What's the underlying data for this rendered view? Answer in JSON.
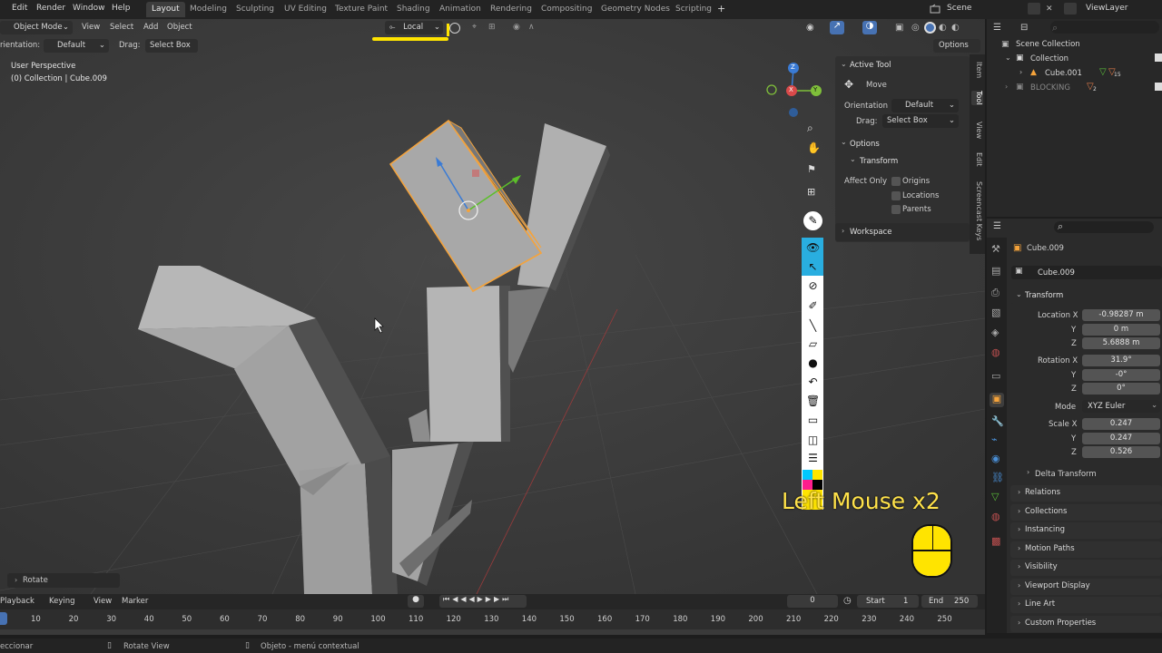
{
  "topbar": {
    "menus": [
      "Edit",
      "Render",
      "Window",
      "Help"
    ],
    "workspaces": [
      "Layout",
      "Modeling",
      "Sculpting",
      "UV Editing",
      "Texture Paint",
      "Shading",
      "Animation",
      "Rendering",
      "Compositing",
      "Geometry Nodes",
      "Scripting"
    ],
    "active_workspace": "Layout",
    "add_tab": "+",
    "scene": "Scene",
    "view_layer": "ViewLayer"
  },
  "viewport_header": {
    "mode": "Object Mode",
    "menus": [
      "View",
      "Select",
      "Add",
      "Object"
    ],
    "transform_orientation": "Local",
    "options": "Options"
  },
  "tool_header": {
    "orientation_label": "rientation:",
    "orientation_value": "Default",
    "drag_label": "Drag:",
    "drag_value": "Select Box"
  },
  "viewport_info": {
    "perspective": "User Perspective",
    "collection": "(0) Collection | Cube.009"
  },
  "gizmo": {
    "x": "X",
    "y": "Y",
    "z": "Z"
  },
  "npanel": {
    "active_tool_title": "Active Tool",
    "tool_name": "Move",
    "orientation_label": "Orientation",
    "orientation_value": "Default",
    "drag_label": "Drag:",
    "drag_value": "Select Box",
    "options_title": "Options",
    "transform_title": "Transform",
    "affect_only_label": "Affect Only",
    "affect_only": [
      "Origins",
      "Locations",
      "Parents"
    ],
    "workspace_title": "Workspace",
    "tabs": [
      "Item",
      "Tool",
      "View",
      "Edit",
      "Screencast Keys"
    ]
  },
  "screencast": {
    "text": "Left Mouse x2"
  },
  "outliner": {
    "root": "Scene Collection",
    "collection": "Collection",
    "object": "Cube.001",
    "object_count": "15",
    "blocking": "BLOCKING",
    "blocking_count": "2"
  },
  "properties": {
    "object_name": "Cube.009",
    "data_name": "Cube.009",
    "transform_title": "Transform",
    "location_label": "Location X",
    "location": [
      "-0.98287 m",
      "0 m",
      "5.6888 m"
    ],
    "rotation_label": "Rotation X",
    "rotation": [
      "31.9°",
      "-0°",
      "0°"
    ],
    "axis_y": "Y",
    "axis_z": "Z",
    "mode_label": "Mode",
    "mode_value": "XYZ Euler",
    "scale_label": "Scale X",
    "scale": [
      "0.247",
      "0.247",
      "0.526"
    ],
    "delta_transform": "Delta Transform",
    "sections": [
      "Relations",
      "Collections",
      "Instancing",
      "Motion Paths",
      "Visibility",
      "Viewport Display",
      "Line Art",
      "Custom Properties"
    ]
  },
  "operator_panel": {
    "label": "Rotate"
  },
  "timeline": {
    "menus": [
      "Playback",
      "Keying",
      "View",
      "Marker"
    ],
    "current_frame": "0",
    "start_label": "Start",
    "start": "1",
    "end_label": "End",
    "end": "250",
    "ticks": [
      "10",
      "20",
      "30",
      "40",
      "50",
      "60",
      "70",
      "80",
      "90",
      "100",
      "110",
      "120",
      "130",
      "140",
      "150",
      "160",
      "170",
      "180",
      "190",
      "200",
      "210",
      "220",
      "230",
      "240",
      "250"
    ]
  },
  "statusbar": {
    "left": "eccionar",
    "middle": "Rotate View",
    "right": "Objeto - menú contextual"
  },
  "colors": {
    "accent_blue": "#4772b3",
    "selection_orange": "#f5a33b",
    "highlight_yellow": "#ffe400",
    "screencast_text": "#ffe24a"
  }
}
